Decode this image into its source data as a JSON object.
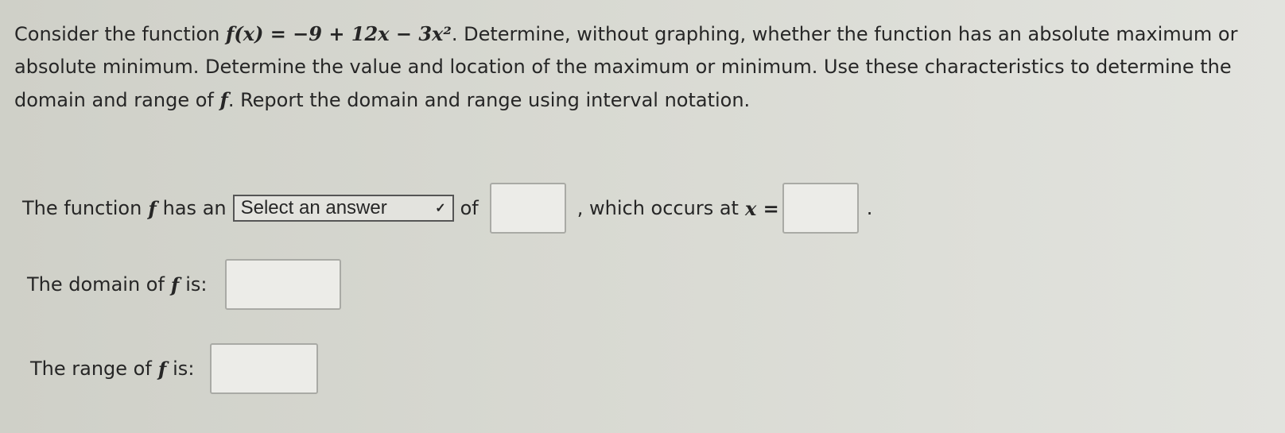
{
  "question": {
    "intro": "Consider the function",
    "function": "f(x) = −9 + 12x − 3x²",
    "text_after_function": ". Determine, without graphing, whether the function has an absolute maximum or absolute minimum. Determine the value and location of the maximum or minimum. Use these characteristics to determine the domain and range of",
    "f_symbol": "f",
    "text_end": ". Report the domain and range using interval notation."
  },
  "line1": {
    "prefix": "The function",
    "f_symbol": "f",
    "has_an": "has an",
    "select": {
      "selected": "Select an answer",
      "icon": "chevron-down-icon"
    },
    "of": "of",
    "value_input": "",
    "which_occurs": ", which occurs at",
    "x_eq": "x =",
    "x_input": "",
    "period": "."
  },
  "domain": {
    "label_pre": "The domain of",
    "f_symbol": "f",
    "label_post": "is:",
    "value": ""
  },
  "range": {
    "label_pre": "The range of",
    "f_symbol": "f",
    "label_post": "is:",
    "value": ""
  }
}
